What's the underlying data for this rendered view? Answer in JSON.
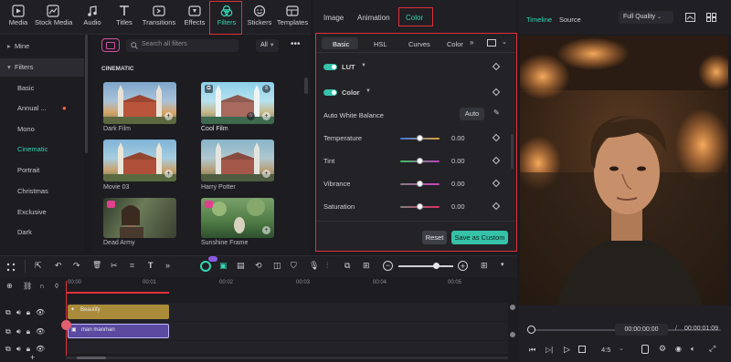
{
  "toolbar": {
    "items": [
      {
        "label": "Media",
        "icon": "media-icon"
      },
      {
        "label": "Stock Media",
        "icon": "stock-media-icon"
      },
      {
        "label": "Audio",
        "icon": "audio-icon"
      },
      {
        "label": "Titles",
        "icon": "titles-icon"
      },
      {
        "label": "Transitions",
        "icon": "transitions-icon"
      },
      {
        "label": "Effects",
        "icon": "effects-icon"
      },
      {
        "label": "Filters",
        "icon": "filters-icon",
        "active": true
      },
      {
        "label": "Stickers",
        "icon": "stickers-icon"
      },
      {
        "label": "Templates",
        "icon": "templates-icon"
      }
    ]
  },
  "sidebar": {
    "mine": "Mine",
    "filters": "Filters",
    "items": [
      "Basic",
      "Annual ...",
      "Mono",
      "Cinematic",
      "Portrait",
      "Christmas",
      "Exclusive",
      "Dark"
    ]
  },
  "filter_grid": {
    "search_placeholder": "Search all filters",
    "filter_dropdown": "All",
    "section": "CINEMATIC",
    "items": [
      "Dark Film",
      "Cool Film",
      "Movie 03",
      "Harry Potter",
      "Dead Army",
      "Sunshine Frame"
    ]
  },
  "property_tabs": [
    "Image",
    "Animation",
    "Color"
  ],
  "color_panel": {
    "subtabs": [
      "Basic",
      "HSL",
      "Curves",
      "Color"
    ],
    "lut": "LUT",
    "color": "Color",
    "auto_white_balance": "Auto White Balance",
    "auto_button": "Auto",
    "sliders": [
      {
        "label": "Temperature",
        "value": "0.00"
      },
      {
        "label": "Tint",
        "value": "0.00"
      },
      {
        "label": "Vibrance",
        "value": "0.00"
      },
      {
        "label": "Saturation",
        "value": "0.00"
      }
    ],
    "reset": "Reset",
    "save_custom": "Save as Custom"
  },
  "preview": {
    "tab_timeline": "Timeline",
    "tab_source": "Source",
    "quality": "Full Quality",
    "current_time": "00:00:00:00",
    "separator": "/",
    "total_time": "00:00:01:09",
    "aspect": "4:5"
  },
  "timeline": {
    "ticks": [
      "00:00",
      "00:01",
      "00:02",
      "00:03",
      "00:04",
      "00:05"
    ],
    "clip_effect": "Beautify",
    "clip_video": "man manman"
  },
  "colors": {
    "accent": "#35d7b5",
    "highlight_border": "#e0303a",
    "effect_clip": "#a98b3a",
    "video_clip": "#5b4aa0"
  }
}
